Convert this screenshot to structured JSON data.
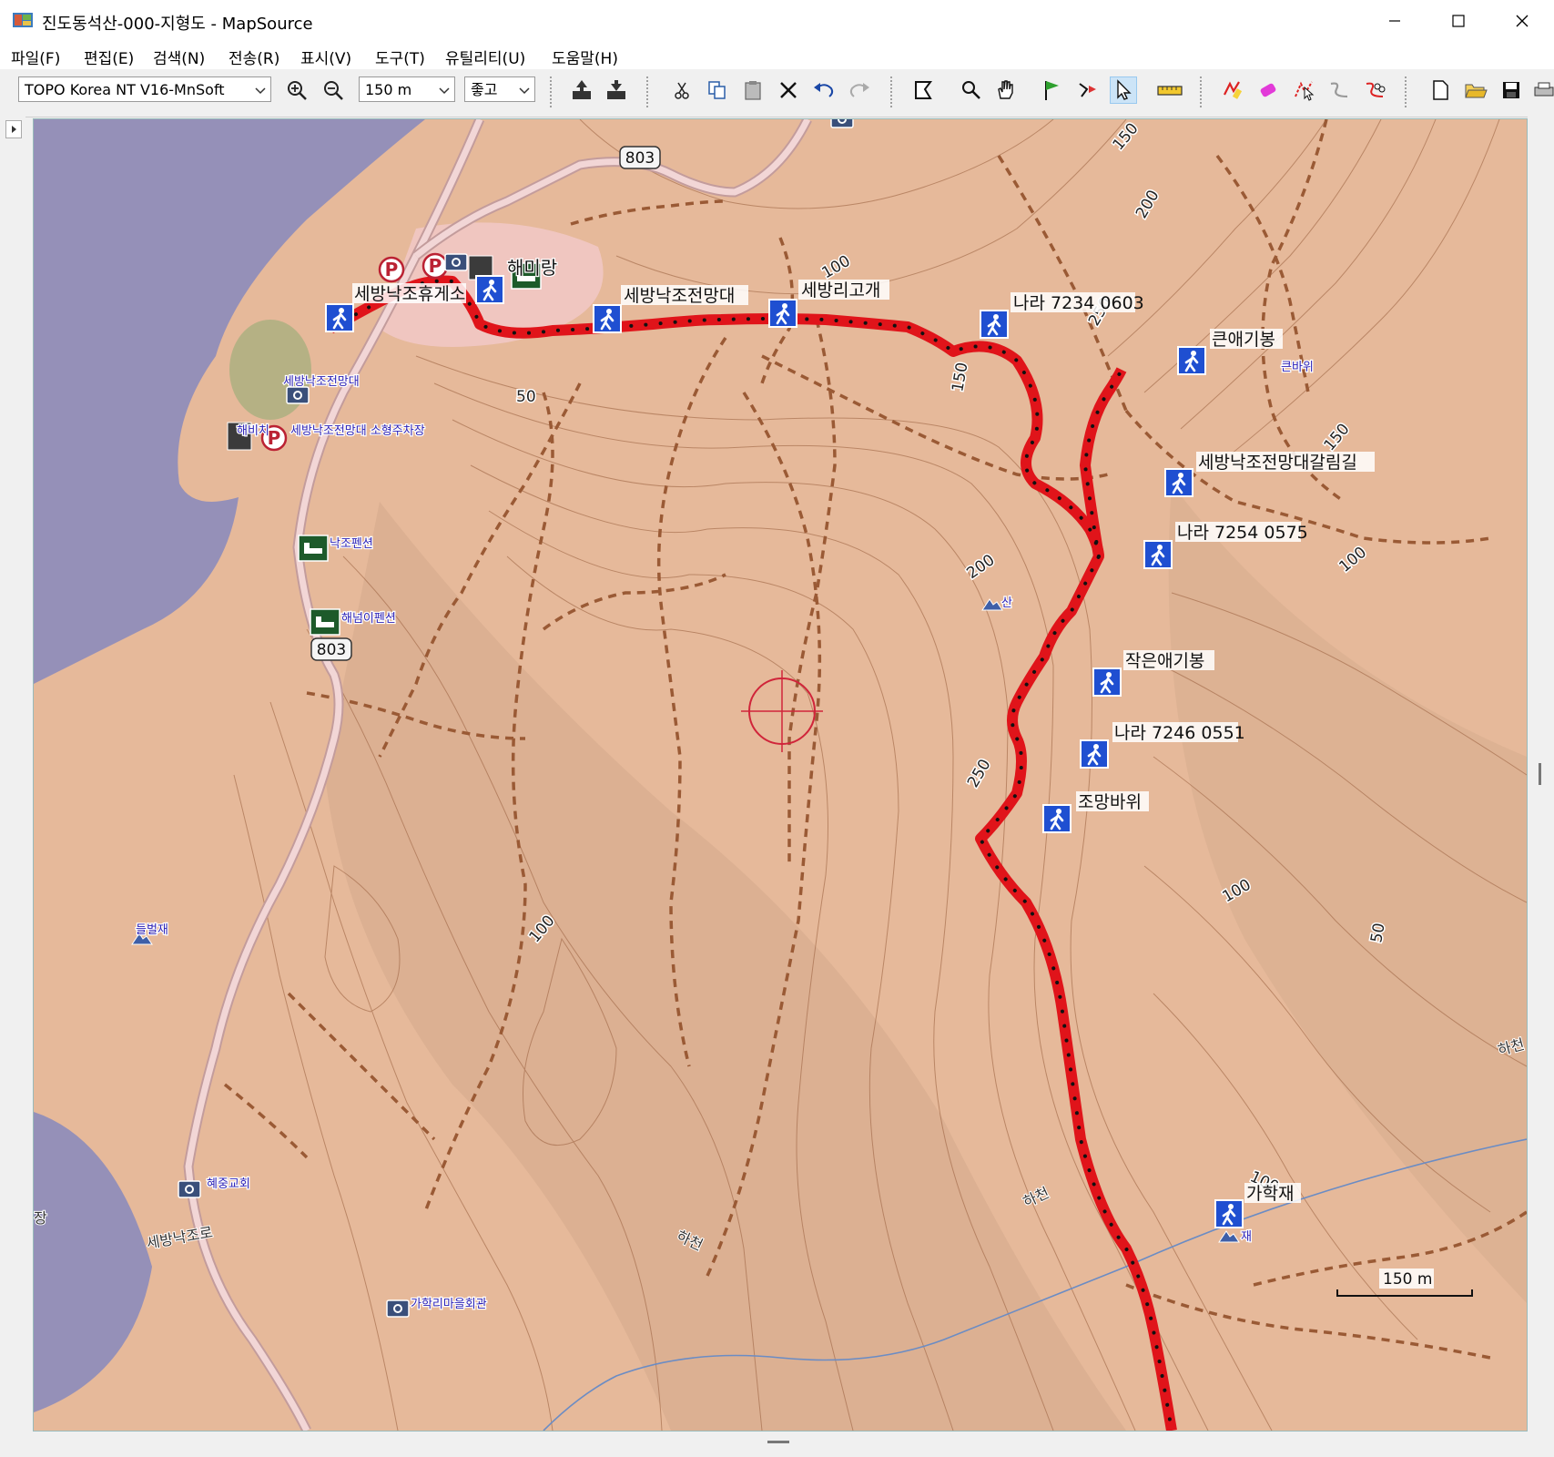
{
  "window": {
    "title": "진도동석산-000-지형도 - MapSource",
    "minimize": "–",
    "maximize": "☐",
    "close": "✕"
  },
  "menu": [
    "파일(F)",
    "편집(E)",
    "검색(N)",
    "전송(R)",
    "표시(V)",
    "도구(T)",
    "유틸리티(U)",
    "도움말(H)"
  ],
  "toolbar": {
    "map_product": "TOPO Korea NT V16-MnSoft",
    "zoom_scale": "150 m",
    "detail_level": "좋고"
  },
  "map": {
    "road_number": "803",
    "waypoints": [
      "세방낙조휴게소",
      "세방낙조전망대",
      "세방리고개",
      "나라 7234 0603",
      "큰애기봉",
      "세방낙조전망대갈림길",
      "나라 7254 0575",
      "작은애기봉",
      "나라 7246 0551",
      "조망바위",
      "가학재"
    ],
    "poi_labels": [
      "해미랑",
      "세방낙조전망대",
      "해비치",
      "세방낙조전망대 소형주차장",
      "낙조펜션",
      "해넘이펜션",
      "들벌재",
      "혜중교회",
      "가학리마을회관",
      "큰바위",
      "산",
      "재",
      "세방낙조로",
      "하천",
      "하천",
      "하천",
      "장"
    ],
    "contour_labels": [
      "150",
      "200",
      "100",
      "250",
      "50",
      "150",
      "200",
      "100",
      "150",
      "250",
      "100",
      "100",
      "100",
      "50",
      "100"
    ],
    "scale_bar": "150 m",
    "colors": {
      "land": "#e6b99a",
      "water": "#9590b8",
      "track": "#e0141a",
      "road": "#f2d6d6",
      "trail": "#a0522d",
      "waypoint_icon": "#1f4fd1"
    }
  }
}
